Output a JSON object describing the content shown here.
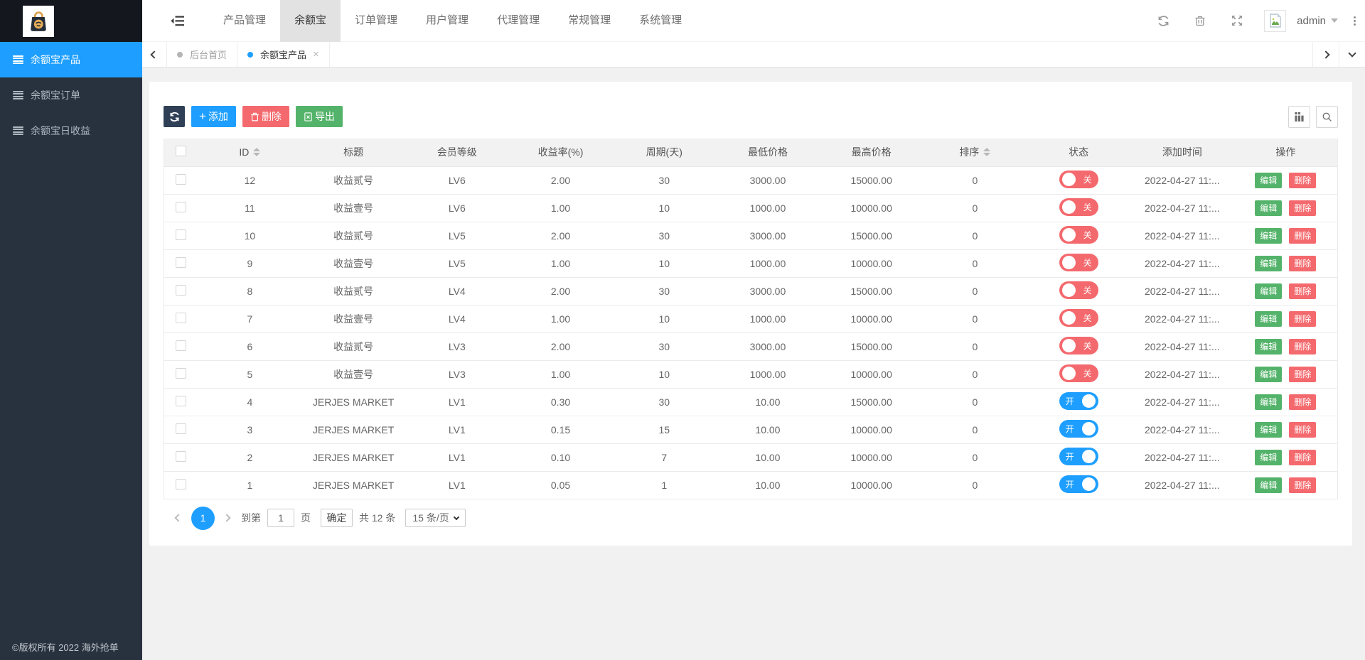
{
  "navbar": {
    "menu": [
      "产品管理",
      "余额宝",
      "订单管理",
      "用户管理",
      "代理管理",
      "常规管理",
      "系统管理"
    ],
    "active_menu": "余额宝",
    "username": "admin"
  },
  "sidebar": {
    "items": [
      {
        "label": "余额宝产品",
        "active": true
      },
      {
        "label": "余额宝订单",
        "active": false
      },
      {
        "label": "余额宝日收益",
        "active": false
      }
    ],
    "copyright": "©版权所有 2022 海外抢单"
  },
  "tabs": [
    {
      "label": "后台首页",
      "closable": false,
      "active": false
    },
    {
      "label": "余额宝产品",
      "closable": true,
      "active": true
    }
  ],
  "toolbar": {
    "add_label": "添加",
    "delete_label": "删除",
    "export_label": "导出"
  },
  "table": {
    "columns": [
      "ID",
      "标题",
      "会员等级",
      "收益率(%)",
      "周期(天)",
      "最低价格",
      "最高价格",
      "排序",
      "状态",
      "添加时间",
      "操作"
    ],
    "sortable_columns": [
      "ID",
      "排序"
    ],
    "switch_on_label": "开",
    "switch_off_label": "关",
    "edit_label": "编辑",
    "delete_label": "删除",
    "rows": [
      {
        "id": "12",
        "title": "收益贰号",
        "level": "LV6",
        "rate": "2.00",
        "period": "30",
        "min": "3000.00",
        "max": "15000.00",
        "sort": "0",
        "status": "off",
        "time": "2022-04-27 11:..."
      },
      {
        "id": "11",
        "title": "收益壹号",
        "level": "LV6",
        "rate": "1.00",
        "period": "10",
        "min": "1000.00",
        "max": "10000.00",
        "sort": "0",
        "status": "off",
        "time": "2022-04-27 11:..."
      },
      {
        "id": "10",
        "title": "收益贰号",
        "level": "LV5",
        "rate": "2.00",
        "period": "30",
        "min": "3000.00",
        "max": "15000.00",
        "sort": "0",
        "status": "off",
        "time": "2022-04-27 11:..."
      },
      {
        "id": "9",
        "title": "收益壹号",
        "level": "LV5",
        "rate": "1.00",
        "period": "10",
        "min": "1000.00",
        "max": "10000.00",
        "sort": "0",
        "status": "off",
        "time": "2022-04-27 11:..."
      },
      {
        "id": "8",
        "title": "收益贰号",
        "level": "LV4",
        "rate": "2.00",
        "period": "30",
        "min": "3000.00",
        "max": "15000.00",
        "sort": "0",
        "status": "off",
        "time": "2022-04-27 11:..."
      },
      {
        "id": "7",
        "title": "收益壹号",
        "level": "LV4",
        "rate": "1.00",
        "period": "10",
        "min": "1000.00",
        "max": "10000.00",
        "sort": "0",
        "status": "off",
        "time": "2022-04-27 11:..."
      },
      {
        "id": "6",
        "title": "收益贰号",
        "level": "LV3",
        "rate": "2.00",
        "period": "30",
        "min": "3000.00",
        "max": "15000.00",
        "sort": "0",
        "status": "off",
        "time": "2022-04-27 11:..."
      },
      {
        "id": "5",
        "title": "收益壹号",
        "level": "LV3",
        "rate": "1.00",
        "period": "10",
        "min": "1000.00",
        "max": "10000.00",
        "sort": "0",
        "status": "off",
        "time": "2022-04-27 11:..."
      },
      {
        "id": "4",
        "title": "JERJES MARKET",
        "level": "LV1",
        "rate": "0.30",
        "period": "30",
        "min": "10.00",
        "max": "15000.00",
        "sort": "0",
        "status": "on",
        "time": "2022-04-27 11:..."
      },
      {
        "id": "3",
        "title": "JERJES MARKET",
        "level": "LV1",
        "rate": "0.15",
        "period": "15",
        "min": "10.00",
        "max": "10000.00",
        "sort": "0",
        "status": "on",
        "time": "2022-04-27 11:..."
      },
      {
        "id": "2",
        "title": "JERJES MARKET",
        "level": "LV1",
        "rate": "0.10",
        "period": "7",
        "min": "10.00",
        "max": "10000.00",
        "sort": "0",
        "status": "on",
        "time": "2022-04-27 11:..."
      },
      {
        "id": "1",
        "title": "JERJES MARKET",
        "level": "LV1",
        "rate": "0.05",
        "period": "1",
        "min": "10.00",
        "max": "10000.00",
        "sort": "0",
        "status": "on",
        "time": "2022-04-27 11:..."
      }
    ]
  },
  "pagination": {
    "current_page": "1",
    "goto_label": "到第",
    "page_unit_label": "页",
    "confirm_label": "确定",
    "total_label": "共 12 条",
    "page_size_label": "15 条/页",
    "goto_value": "1"
  },
  "colors": {
    "accent_blue": "#1e9fff",
    "danger_red": "#f4696d",
    "success_green": "#54b36a",
    "dark_navy": "#2f4056",
    "sidebar_bg": "#28323f"
  }
}
